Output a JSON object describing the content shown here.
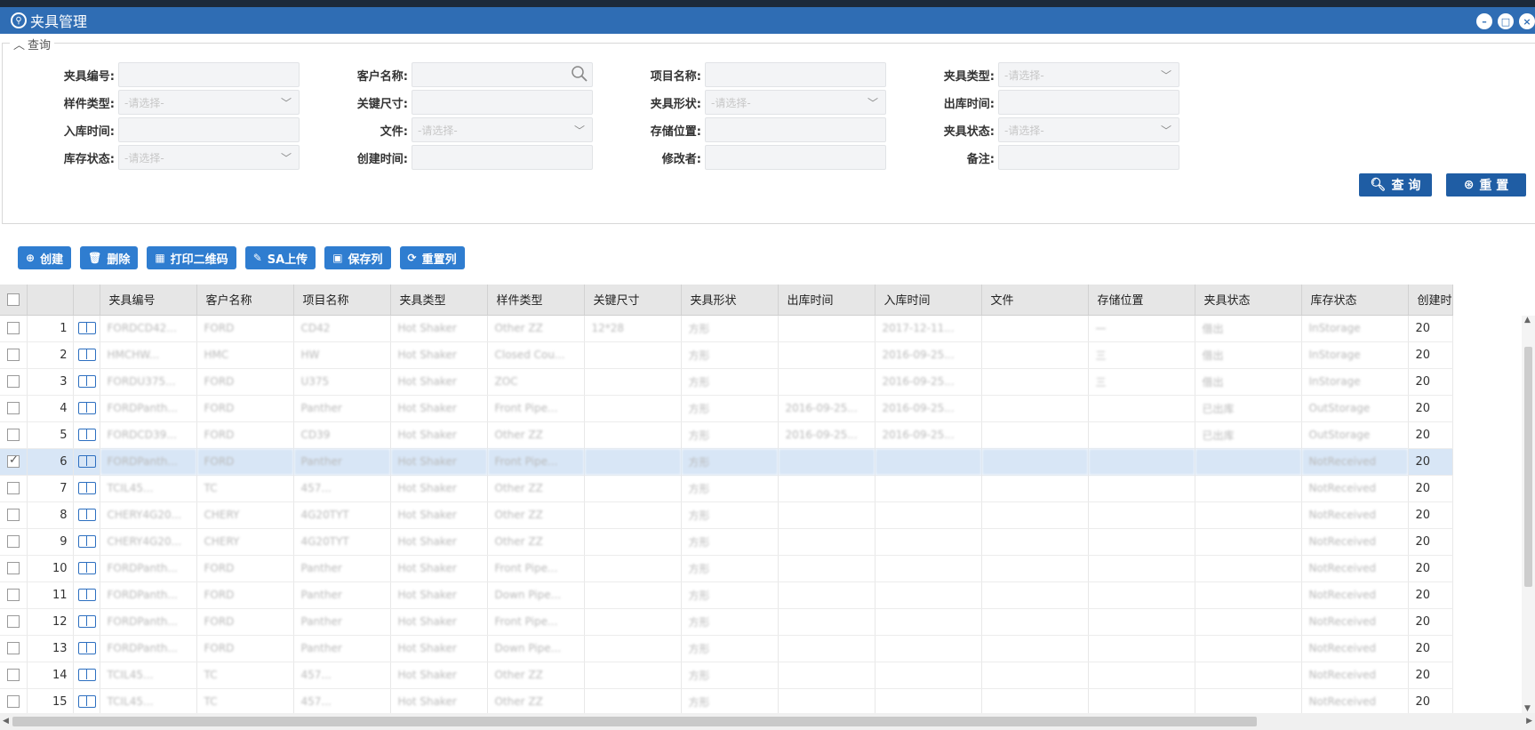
{
  "window": {
    "title": "夹具管理"
  },
  "query": {
    "legend": "查询",
    "fields": [
      {
        "label": "夹具编号:",
        "placeholder": ""
      },
      {
        "label": "客户名称:",
        "placeholder": ""
      },
      {
        "label": "项目名称:",
        "placeholder": ""
      },
      {
        "label": "夹具类型:",
        "placeholder": "-请选择-"
      },
      {
        "label": "样件类型:",
        "placeholder": "-请选择-"
      },
      {
        "label": "关键尺寸:",
        "placeholder": ""
      },
      {
        "label": "夹具形状:",
        "placeholder": "-请选择-"
      },
      {
        "label": "出库时间:",
        "placeholder": ""
      },
      {
        "label": "入库时间:",
        "placeholder": ""
      },
      {
        "label": "文件:",
        "placeholder": "-请选择-"
      },
      {
        "label": "存储位置:",
        "placeholder": ""
      },
      {
        "label": "夹具状态:",
        "placeholder": "-请选择-"
      },
      {
        "label": "库存状态:",
        "placeholder": "-请选择-"
      },
      {
        "label": "创建时间:",
        "placeholder": ""
      },
      {
        "label": "修改者:",
        "placeholder": ""
      },
      {
        "label": "备注:",
        "placeholder": ""
      }
    ],
    "search_label": "查 询",
    "reset_label": "重 置"
  },
  "toolbar": {
    "create": "创建",
    "delete": "删除",
    "print_qr": "打印二维码",
    "sa_upload": "SA上传",
    "save_cols": "保存列",
    "reset_cols": "重置列"
  },
  "table": {
    "columns": [
      "夹具编号",
      "客户名称",
      "项目名称",
      "夹具类型",
      "样件类型",
      "关键尺寸",
      "夹具形状",
      "出库时间",
      "入库时间",
      "文件",
      "存储位置",
      "夹具状态",
      "库存状态",
      "创建时"
    ],
    "selected_row": 6,
    "rows": [
      {
        "no": "1",
        "cells": [
          "FORDCD42...",
          "FORD",
          "CD42",
          "Hot Shaker",
          "Other ZZ",
          "12*28",
          "方形",
          "",
          "2017-12-11...",
          "",
          "一",
          "借出",
          "InStorage"
        ],
        "last": "20"
      },
      {
        "no": "2",
        "cells": [
          "HMCHW...",
          "HMC",
          "HW",
          "Hot Shaker",
          "Closed Cou...",
          "",
          "方形",
          "",
          "2016-09-25...",
          "",
          "三",
          "借出",
          "InStorage"
        ],
        "last": "20"
      },
      {
        "no": "3",
        "cells": [
          "FORDU375...",
          "FORD",
          "U375",
          "Hot Shaker",
          "ZOC",
          "",
          "方形",
          "",
          "2016-09-25...",
          "",
          "三",
          "借出",
          "InStorage"
        ],
        "last": "20"
      },
      {
        "no": "4",
        "cells": [
          "FORDPanth...",
          "FORD",
          "Panther",
          "Hot Shaker",
          "Front Pipe...",
          "",
          "方形",
          "2016-09-25...",
          "2016-09-25...",
          "",
          "",
          "已出库",
          "OutStorage"
        ],
        "last": "20"
      },
      {
        "no": "5",
        "cells": [
          "FORDCD39...",
          "FORD",
          "CD39",
          "Hot Shaker",
          "Other ZZ",
          "",
          "方形",
          "2016-09-25...",
          "2016-09-25...",
          "",
          "",
          "已出库",
          "OutStorage"
        ],
        "last": "20"
      },
      {
        "no": "6",
        "cells": [
          "FORDPanth...",
          "FORD",
          "Panther",
          "Hot Shaker",
          "Front Pipe...",
          "",
          "方形",
          "",
          "",
          "",
          "",
          "",
          "NotReceived"
        ],
        "last": "20"
      },
      {
        "no": "7",
        "cells": [
          "TCIL45...",
          "TC",
          "457...",
          "Hot Shaker",
          "Other ZZ",
          "",
          "方形",
          "",
          "",
          "",
          "",
          "",
          "NotReceived"
        ],
        "last": "20"
      },
      {
        "no": "8",
        "cells": [
          "CHERY4G20...",
          "CHERY",
          "4G20TYT",
          "Hot Shaker",
          "Other ZZ",
          "",
          "方形",
          "",
          "",
          "",
          "",
          "",
          "NotReceived"
        ],
        "last": "20"
      },
      {
        "no": "9",
        "cells": [
          "CHERY4G20...",
          "CHERY",
          "4G20TYT",
          "Hot Shaker",
          "Other ZZ",
          "",
          "方形",
          "",
          "",
          "",
          "",
          "",
          "NotReceived"
        ],
        "last": "20"
      },
      {
        "no": "10",
        "cells": [
          "FORDPanth...",
          "FORD",
          "Panther",
          "Hot Shaker",
          "Front Pipe...",
          "",
          "方形",
          "",
          "",
          "",
          "",
          "",
          "NotReceived"
        ],
        "last": "20"
      },
      {
        "no": "11",
        "cells": [
          "FORDPanth...",
          "FORD",
          "Panther",
          "Hot Shaker",
          "Down Pipe...",
          "",
          "方形",
          "",
          "",
          "",
          "",
          "",
          "NotReceived"
        ],
        "last": "20"
      },
      {
        "no": "12",
        "cells": [
          "FORDPanth...",
          "FORD",
          "Panther",
          "Hot Shaker",
          "Front Pipe...",
          "",
          "方形",
          "",
          "",
          "",
          "",
          "",
          "NotReceived"
        ],
        "last": "20"
      },
      {
        "no": "13",
        "cells": [
          "FORDPanth...",
          "FORD",
          "Panther",
          "Hot Shaker",
          "Down Pipe...",
          "",
          "方形",
          "",
          "",
          "",
          "",
          "",
          "NotReceived"
        ],
        "last": "20"
      },
      {
        "no": "14",
        "cells": [
          "TCIL45...",
          "TC",
          "457...",
          "Hot Shaker",
          "Other ZZ",
          "",
          "方形",
          "",
          "",
          "",
          "",
          "",
          "NotReceived"
        ],
        "last": "20"
      },
      {
        "no": "15",
        "cells": [
          "TCIL45...",
          "TC",
          "457...",
          "Hot Shaker",
          "Other ZZ",
          "",
          "方形",
          "",
          "",
          "",
          "",
          "",
          "NotReceived"
        ],
        "last": "20"
      }
    ]
  }
}
